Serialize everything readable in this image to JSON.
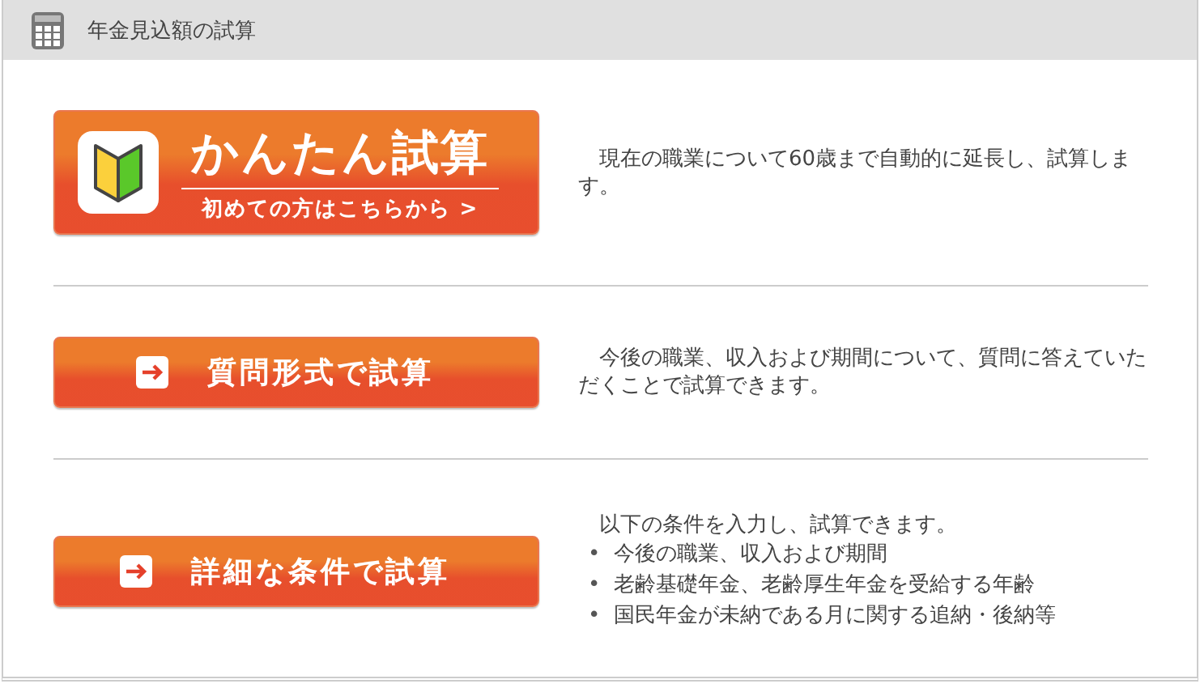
{
  "header": {
    "title": "年金見込額の試算"
  },
  "options": [
    {
      "kind": "beginner",
      "title": "かんたん試算",
      "subtitle": "初めての方はこちらから >",
      "description": "現在の職業について60歳まで自動的に延長し、試算します。"
    },
    {
      "kind": "arrow",
      "title": "質問形式で試算",
      "description": "今後の職業、収入および期間について、質問に答えていただくことで試算できます。"
    },
    {
      "kind": "arrow",
      "title": "詳細な条件で試算",
      "description": "以下の条件を入力し、試算できます。",
      "bullets": [
        {
          "marker": "•",
          "text": "今後の職業、収入および期間"
        },
        {
          "marker": "•",
          "text": "老齢基礎年金、老齢厚生年金を受給する年齢"
        },
        {
          "marker": "•",
          "text": "国民年金が未納である月に関する追納・後納等"
        }
      ]
    }
  ]
}
